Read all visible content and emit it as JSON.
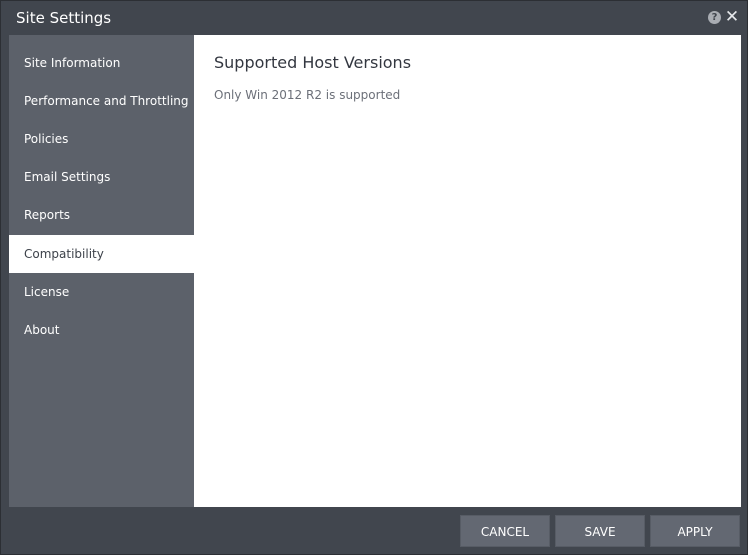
{
  "window": {
    "title": "Site Settings",
    "help_icon": "?",
    "close_icon": "✕"
  },
  "sidebar": {
    "items": [
      {
        "label": "Site Information"
      },
      {
        "label": "Performance and Throttling"
      },
      {
        "label": "Policies"
      },
      {
        "label": "Email Settings"
      },
      {
        "label": "Reports"
      },
      {
        "label": "Compatibility",
        "active": true
      },
      {
        "label": "License"
      },
      {
        "label": "About"
      }
    ]
  },
  "main": {
    "title": "Supported Host Versions",
    "text": "Only Win 2012 R2 is supported"
  },
  "footer": {
    "cancel_label": "CANCEL",
    "save_label": "SAVE",
    "apply_label": "APPLY"
  },
  "colors": {
    "chrome": "#41464e",
    "sidebar": "#5c616a",
    "active_item": "#ffffff",
    "button": "#636872"
  }
}
